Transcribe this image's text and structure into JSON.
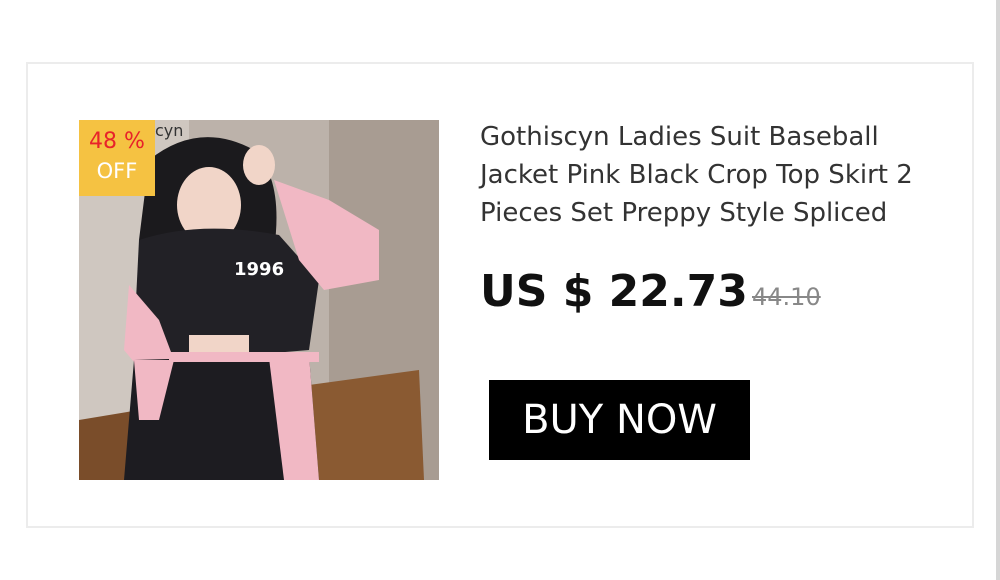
{
  "product": {
    "title": "Gothiscyn Ladies Suit Baseball Jacket Pink Black Crop Top Skirt 2 Pieces Set Preppy Style Spliced",
    "image_alt": "Girl wearing pink and black baseball jacket crop top and skirt set"
  },
  "discount": {
    "percent": "48 %",
    "label": "OFF"
  },
  "price": {
    "current": "US $ 22.73",
    "original": "44.10"
  },
  "cta": {
    "label": "BUY NOW"
  },
  "photo_text": {
    "watermark": "cyn",
    "jacket_number": "1996"
  },
  "colors": {
    "badge_bg": "#f5c242",
    "badge_percent": "#e8222a",
    "button_bg": "#000000"
  }
}
